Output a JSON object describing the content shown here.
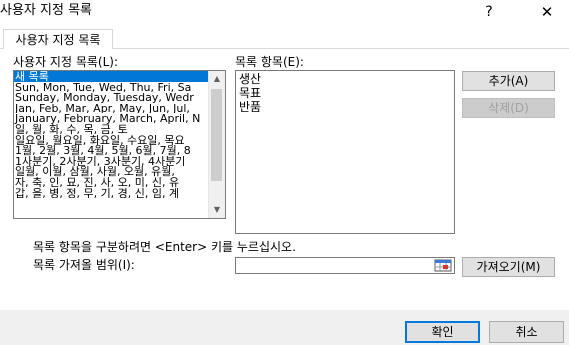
{
  "window": {
    "title": "사용자 지정 목록",
    "help_label": "?",
    "close_label": "✕"
  },
  "tab": {
    "label": "사용자 지정 목록"
  },
  "lists_panel": {
    "label": "사용자 지정 목록(L):",
    "items": [
      "새 목록",
      "Sun, Mon, Tue, Wed, Thu, Fri, Sa",
      "Sunday, Monday, Tuesday, Wedr",
      "Jan, Feb, Mar, Apr, May, Jun, Jul,",
      "January, February, March, April, N",
      "일, 월, 화, 수, 목, 금, 토",
      "일요일, 월요일, 화요일, 수요일, 목요",
      "1월, 2월, 3월, 4월, 5월, 6월, 7월, 8",
      "1사분기, 2사분기, 3사분기, 4사분기",
      "일월, 이월, 삼월, 사월, 오월, 유월,",
      "자, 축, 인, 묘, 진, 사, 오, 미, 신, 유",
      "갑, 을, 병, 정, 무, 기, 경, 신, 임, 계"
    ],
    "selected_index": 0
  },
  "entries_panel": {
    "label": "목록 항목(E):",
    "lines": [
      "생산",
      "목표",
      "반품"
    ]
  },
  "buttons": {
    "add": "추가(A)",
    "delete": "삭제(D)",
    "import": "가져오기(M)",
    "ok": "확인",
    "cancel": "취소"
  },
  "hint": "목록 항목을 구분하려면 <Enter> 키를 누르십시오.",
  "import_range": {
    "label": "목록 가져올 범위(I):",
    "value": ""
  }
}
